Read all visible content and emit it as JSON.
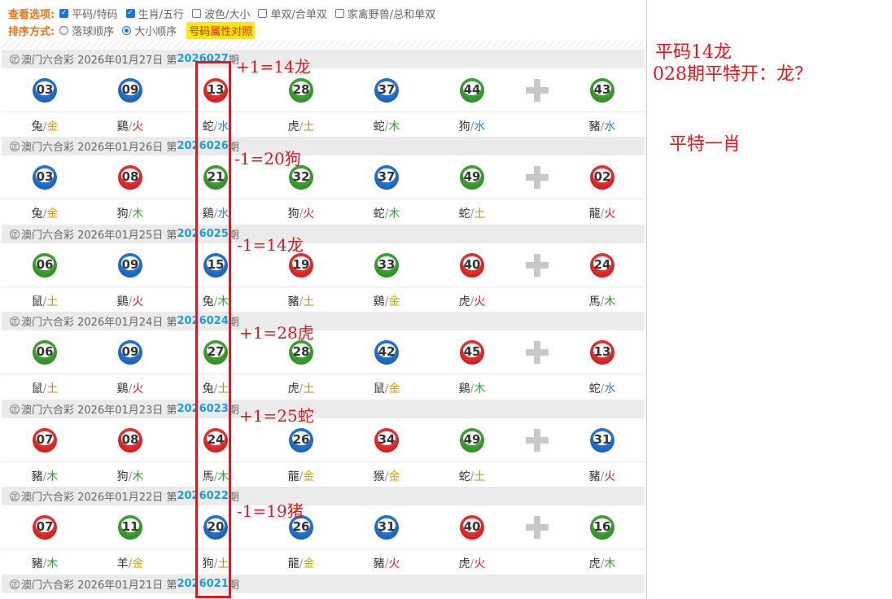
{
  "options": {
    "view_label": "查看选项:",
    "view_items": [
      {
        "label": "平码/特码",
        "checked": true
      },
      {
        "label": "生肖/五行",
        "checked": true
      },
      {
        "label": "波色/大小",
        "checked": false
      },
      {
        "label": "单双/合单双",
        "checked": false
      },
      {
        "label": "家禽野兽/总和单双",
        "checked": false
      }
    ],
    "sort_label": "排序方式:",
    "sort_items": [
      {
        "label": "落球顺序",
        "selected": false
      },
      {
        "label": "大小顺序",
        "selected": true
      }
    ],
    "compare_button": "号码属性对照"
  },
  "draws": [
    {
      "mark": "正",
      "prefix": "澳门六合彩 2026年01月27日 第",
      "issue": "2026027",
      "suffix": "期",
      "balls": [
        {
          "num": "03",
          "color": "blue",
          "zodiac": "兔",
          "element": "金"
        },
        {
          "num": "09",
          "color": "blue",
          "zodiac": "鷄",
          "element": "火"
        },
        {
          "num": "13",
          "color": "red",
          "zodiac": "蛇",
          "element": "水"
        },
        {
          "num": "28",
          "color": "green",
          "zodiac": "虎",
          "element": "土"
        },
        {
          "num": "37",
          "color": "blue",
          "zodiac": "蛇",
          "element": "木"
        },
        {
          "num": "44",
          "color": "green",
          "zodiac": "狗",
          "element": "水"
        },
        {
          "num": "43",
          "color": "green",
          "zodiac": "豬",
          "element": "水"
        }
      ]
    },
    {
      "mark": "正",
      "prefix": "澳门六合彩 2026年01月26日 第",
      "issue": "2026026",
      "suffix": "期",
      "balls": [
        {
          "num": "03",
          "color": "blue",
          "zodiac": "兔",
          "element": "金"
        },
        {
          "num": "08",
          "color": "red",
          "zodiac": "狗",
          "element": "木"
        },
        {
          "num": "21",
          "color": "green",
          "zodiac": "鷄",
          "element": "水"
        },
        {
          "num": "32",
          "color": "green",
          "zodiac": "狗",
          "element": "火"
        },
        {
          "num": "37",
          "color": "blue",
          "zodiac": "蛇",
          "element": "木"
        },
        {
          "num": "49",
          "color": "green",
          "zodiac": "蛇",
          "element": "土"
        },
        {
          "num": "02",
          "color": "red",
          "zodiac": "龍",
          "element": "火"
        }
      ]
    },
    {
      "mark": "正",
      "prefix": "澳门六合彩 2026年01月25日 第",
      "issue": "2026025",
      "suffix": "期",
      "balls": [
        {
          "num": "06",
          "color": "green",
          "zodiac": "鼠",
          "element": "土"
        },
        {
          "num": "09",
          "color": "blue",
          "zodiac": "鷄",
          "element": "火"
        },
        {
          "num": "15",
          "color": "blue",
          "zodiac": "兔",
          "element": "木"
        },
        {
          "num": "19",
          "color": "red",
          "zodiac": "豬",
          "element": "土"
        },
        {
          "num": "33",
          "color": "green",
          "zodiac": "鷄",
          "element": "金"
        },
        {
          "num": "40",
          "color": "red",
          "zodiac": "虎",
          "element": "火"
        },
        {
          "num": "24",
          "color": "red",
          "zodiac": "馬",
          "element": "木"
        }
      ]
    },
    {
      "mark": "正",
      "prefix": "澳门六合彩 2026年01月24日 第",
      "issue": "2026024",
      "suffix": "期",
      "balls": [
        {
          "num": "06",
          "color": "green",
          "zodiac": "鼠",
          "element": "土"
        },
        {
          "num": "09",
          "color": "blue",
          "zodiac": "鷄",
          "element": "火"
        },
        {
          "num": "27",
          "color": "green",
          "zodiac": "兔",
          "element": "土"
        },
        {
          "num": "28",
          "color": "green",
          "zodiac": "虎",
          "element": "土"
        },
        {
          "num": "42",
          "color": "blue",
          "zodiac": "鼠",
          "element": "金"
        },
        {
          "num": "45",
          "color": "red",
          "zodiac": "鷄",
          "element": "木"
        },
        {
          "num": "13",
          "color": "red",
          "zodiac": "蛇",
          "element": "水"
        }
      ]
    },
    {
      "mark": "正",
      "prefix": "澳门六合彩 2026年01月23日 第",
      "issue": "2026023",
      "suffix": "期",
      "balls": [
        {
          "num": "07",
          "color": "red",
          "zodiac": "豬",
          "element": "木"
        },
        {
          "num": "08",
          "color": "red",
          "zodiac": "狗",
          "element": "木"
        },
        {
          "num": "24",
          "color": "red",
          "zodiac": "馬",
          "element": "木"
        },
        {
          "num": "26",
          "color": "blue",
          "zodiac": "龍",
          "element": "金"
        },
        {
          "num": "34",
          "color": "red",
          "zodiac": "猴",
          "element": "金"
        },
        {
          "num": "49",
          "color": "green",
          "zodiac": "蛇",
          "element": "土"
        },
        {
          "num": "31",
          "color": "blue",
          "zodiac": "豬",
          "element": "火"
        }
      ]
    },
    {
      "mark": "正",
      "prefix": "澳门六合彩 2026年01月22日 第",
      "issue": "2026022",
      "suffix": "期",
      "balls": [
        {
          "num": "07",
          "color": "red",
          "zodiac": "豬",
          "element": "木"
        },
        {
          "num": "11",
          "color": "green",
          "zodiac": "羊",
          "element": "金"
        },
        {
          "num": "20",
          "color": "blue",
          "zodiac": "狗",
          "element": "土"
        },
        {
          "num": "26",
          "color": "blue",
          "zodiac": "龍",
          "element": "金"
        },
        {
          "num": "31",
          "color": "blue",
          "zodiac": "豬",
          "element": "火"
        },
        {
          "num": "40",
          "color": "red",
          "zodiac": "虎",
          "element": "火"
        },
        {
          "num": "16",
          "color": "green",
          "zodiac": "虎",
          "element": "木"
        }
      ]
    },
    {
      "mark": "正",
      "prefix": "澳门六合彩 2026年01月21日 第",
      "issue": "2026021",
      "suffix": "期",
      "balls": []
    }
  ],
  "annotations": {
    "row_notes": [
      "+1=14龙",
      "-1=20狗",
      "-1=14龙",
      "+1=28虎",
      "+1=25蛇",
      "-1=19猪"
    ],
    "right_line1": "平码14龙",
    "right_line2": "028期平特开：龙？",
    "right_line3": "平特一肖"
  },
  "colors": {
    "red_ball": "#d81d1d",
    "blue_ball": "#1a63c0",
    "green_ball": "#2f9127",
    "annotation_red": "#e8141c",
    "issue_blue": "#1d9be0",
    "label_orange": "#e8741e"
  }
}
